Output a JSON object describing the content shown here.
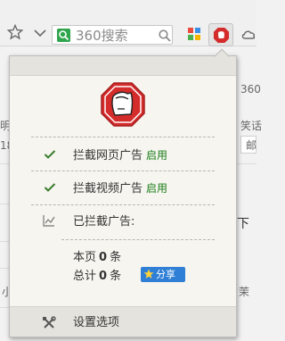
{
  "toolbar": {
    "search_text": "360搜索",
    "icons": [
      "star-icon",
      "chevron-down-icon",
      "search-engine-logo-icon",
      "magnifier-icon",
      "apps-grid-icon",
      "stop-ad-icon",
      "cloud-icon"
    ]
  },
  "background": {
    "frag_360": "360",
    "frag_ming": "明",
    "frag_18": "18",
    "frag_xiao": "笑话",
    "frag_you": "邮",
    "frag_xia": "下",
    "frag_xiao2": "小",
    "frag_mo": "茉"
  },
  "popup": {
    "items": [
      {
        "label": "拦截网页广告",
        "status": "启用"
      },
      {
        "label": "拦截视频广告",
        "status": "启用"
      }
    ],
    "blocked_label": "已拦截广告:",
    "this_page": {
      "prefix": "本页",
      "count": "0",
      "unit": "条"
    },
    "total": {
      "prefix": "总计",
      "count": "0",
      "unit": "条"
    },
    "share_label": "分享",
    "settings_label": "设置选项"
  },
  "colors": {
    "status_green": "#1a7d1a",
    "share_blue": "#2f7fd6",
    "stop_red": "#d42b2b"
  }
}
